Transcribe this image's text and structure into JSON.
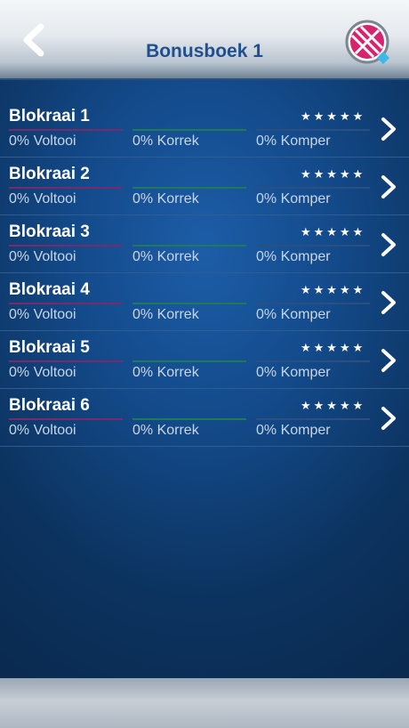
{
  "header": {
    "title": "Bonusboek 1",
    "back_icon": "back-arrow-icon",
    "logo_icon": "app-logo-icon"
  },
  "rows": [
    {
      "title": "Blokraai 1",
      "stars": "★★★★★",
      "voltooi": "0% Voltooi",
      "korrek": "0% Korrek",
      "komper": "0% Komper"
    },
    {
      "title": "Blokraai 2",
      "stars": "★★★★★",
      "voltooi": "0% Voltooi",
      "korrek": "0% Korrek",
      "komper": "0% Komper"
    },
    {
      "title": "Blokraai 3",
      "stars": "★★★★★",
      "voltooi": "0% Voltooi",
      "korrek": "0% Korrek",
      "komper": "0% Komper"
    },
    {
      "title": "Blokraai 4",
      "stars": "★★★★★",
      "voltooi": "0% Voltooi",
      "korrek": "0% Korrek",
      "komper": "0% Komper"
    },
    {
      "title": "Blokraai 5",
      "stars": "★★★★★",
      "voltooi": "0% Voltooi",
      "korrek": "0% Korrek",
      "komper": "0% Komper"
    },
    {
      "title": "Blokraai 6",
      "stars": "★★★★★",
      "voltooi": "0% Voltooi",
      "korrek": "0% Korrek",
      "komper": "0% Komper"
    }
  ],
  "colors": {
    "accent_title": "#1f4f8f",
    "voltooi_bar": "#7a2a6a",
    "korrek_bar": "#1f7a58",
    "komper_bar": "#2a4f80",
    "logo_pink": "#d6246e"
  }
}
